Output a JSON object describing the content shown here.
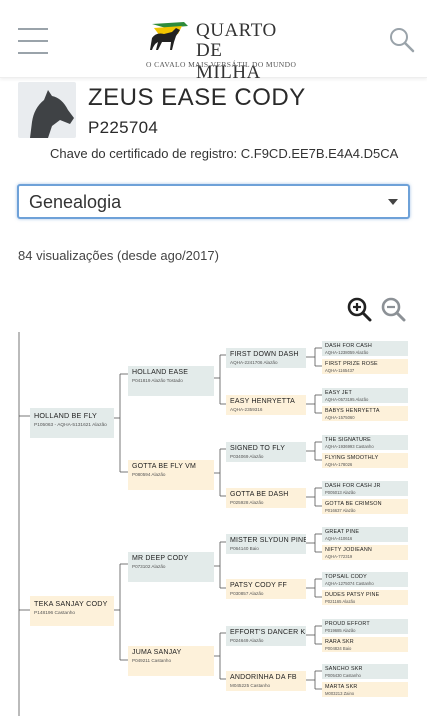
{
  "header": {
    "menu_icon": "hamburger-icon",
    "search_icon": "search-icon",
    "logo": {
      "line1": "QUARTO",
      "line2": "DE MILHA",
      "tagline": "O CAVALO MAIS VERSÁTIL DO MUNDO"
    }
  },
  "horse": {
    "name": "ZEUS EASE CODY",
    "registration": "P225704",
    "certificate": "Chave do certificado de registro: C.F9CD.EE7B.E4A4.D5CA",
    "avatar_icon": "horse-head-icon"
  },
  "section_select": {
    "value": "Genealogia"
  },
  "views": "84 visualizações (desde ago/2017)",
  "zoom": {
    "in_icon": "zoom-in-icon",
    "out_icon": "zoom-out-icon"
  },
  "colors": {
    "sire_box": "#e3ebea",
    "dam_box": "#fdf1da",
    "select_border": "#6ea1d8"
  },
  "pedigree": {
    "g1": [
      {
        "name": "HOLLAND BE FLY",
        "sub": "P105063 - AQHA-5131621 Alazão"
      },
      {
        "name": "TEKA SANJAY CODY",
        "sub": "P148196 Castanho"
      }
    ],
    "g2": [
      {
        "name": "HOLLAND EASE",
        "sub": "P041819 Alazão Tostado"
      },
      {
        "name": "GOTTA BE FLY VM",
        "sub": "P080594 Alazão"
      },
      {
        "name": "MR DEEP CODY",
        "sub": "P073102 Alazão"
      },
      {
        "name": "JUMA SANJAY",
        "sub": "P049211 Castanho"
      }
    ],
    "g3": [
      {
        "name": "FIRST DOWN DASH",
        "sub": "AQHA-2241706 Alazão"
      },
      {
        "name": "EASY HENRYETTA",
        "sub": "AQHA-2359316"
      },
      {
        "name": "SIGNED TO FLY",
        "sub": "P034069 Alazão"
      },
      {
        "name": "GOTTA BE DASH",
        "sub": "P025928 Alazão"
      },
      {
        "name": "MISTER SLYDUN PINE",
        "sub": "P064140 Baio"
      },
      {
        "name": "PATSY CODY FF",
        "sub": "P030857 Alazão"
      },
      {
        "name": "EFFORT'S DANCER KRB",
        "sub": "P024649 Alazão"
      },
      {
        "name": "ANDORINHA DA FB",
        "sub": "M045225 Castanho"
      }
    ],
    "g4": [
      {
        "name": "DASH FOR CASH",
        "sub": "AQHA-1238059 Alazão"
      },
      {
        "name": "FIRST PRIZE ROSE",
        "sub": "AQHA-1165437"
      },
      {
        "name": "EASY JET",
        "sub": "AQHA-0573195 Alazão"
      },
      {
        "name": "BABYS HENRYETTA",
        "sub": "AQHA-1575060"
      },
      {
        "name": "THE SIGNATURE",
        "sub": "AQHA-1936993 Castanho"
      },
      {
        "name": "FLYING SMOOTHLY",
        "sub": "AQHA-178026"
      },
      {
        "name": "DASH FOR CASH JR",
        "sub": "P005013 Alazão"
      },
      {
        "name": "GOTTA BE CRIMSON",
        "sub": "P016637 Alazão"
      },
      {
        "name": "GREAT PINE",
        "sub": "AQHA-410616"
      },
      {
        "name": "NIFTY JODIEANN",
        "sub": "AQHA-772319"
      },
      {
        "name": "TOPSAIL CODY",
        "sub": "AQHA-1275074 Castanho"
      },
      {
        "name": "DUDES PATSY PINE",
        "sub": "P021165 Alazão"
      },
      {
        "name": "PROUD EFFORT",
        "sub": "P019685 Alazão"
      },
      {
        "name": "RARA SKR",
        "sub": "P004824 Baio"
      },
      {
        "name": "SANCHO SKR",
        "sub": "P005430 Castanho"
      },
      {
        "name": "MARTA SKR",
        "sub": "M003213 Zaino"
      }
    ]
  }
}
